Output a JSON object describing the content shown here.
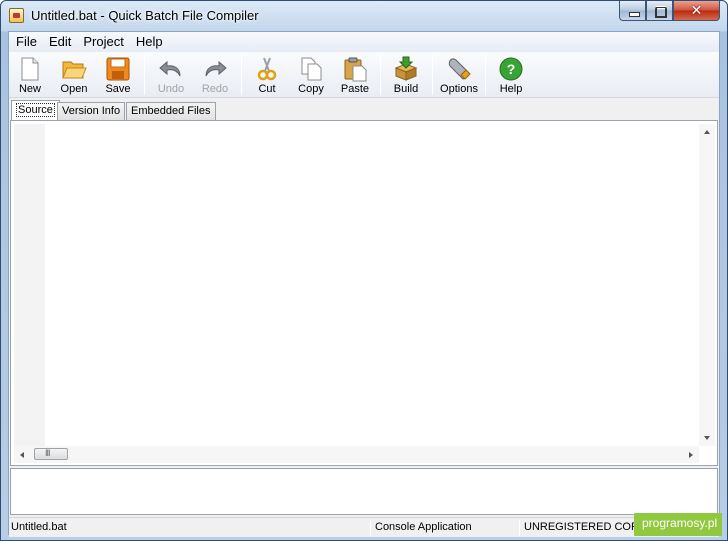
{
  "window": {
    "title": "Untitled.bat - Quick Batch File Compiler",
    "close_glyph": "✕"
  },
  "menu": [
    "File",
    "Edit",
    "Project",
    "Help"
  ],
  "toolbar": {
    "new": "New",
    "open": "Open",
    "save": "Save",
    "undo": "Undo",
    "redo": "Redo",
    "cut": "Cut",
    "copy": "Copy",
    "paste": "Paste",
    "build": "Build",
    "options": "Options",
    "help": "Help"
  },
  "tabs": [
    "Source",
    "Version Info",
    "Embedded Files"
  ],
  "active_tab": "Source",
  "statusbar": {
    "file": "Untitled.bat",
    "app_type": "Console Application",
    "registration": "UNREGISTERED COPY"
  },
  "watermark": "programosy.pl",
  "colors": {
    "help_green": "#3aa335",
    "build_green": "#3d9e2c",
    "watermark_green": "#90c93f"
  }
}
